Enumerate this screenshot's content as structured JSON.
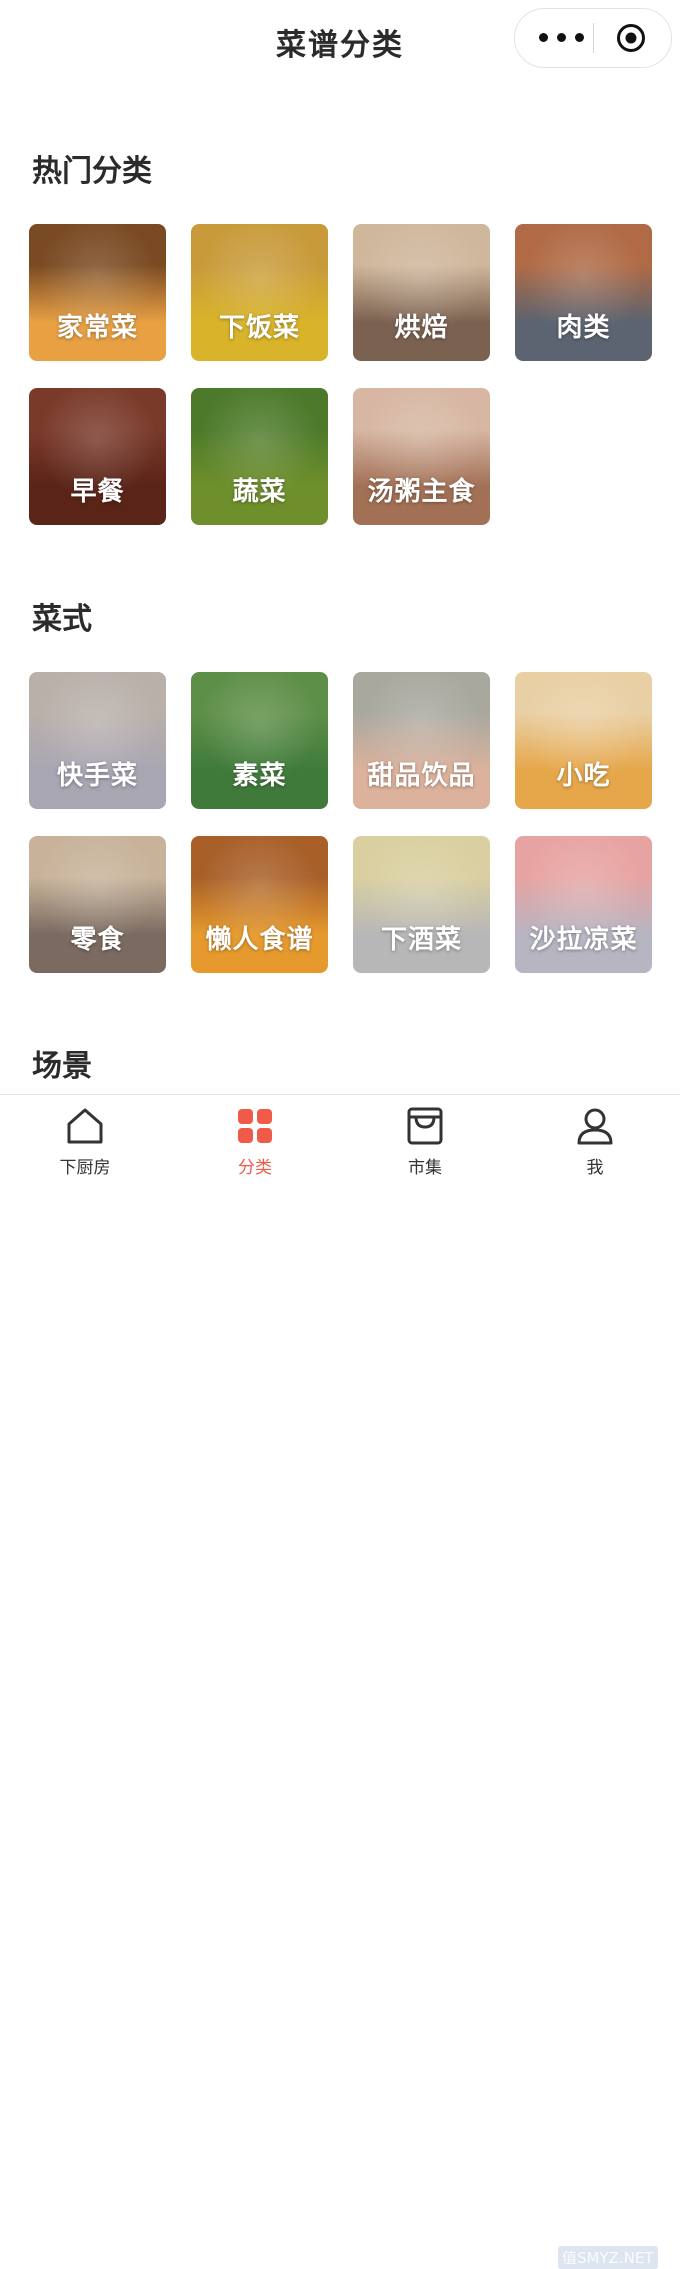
{
  "nav": {
    "title": "菜谱分类"
  },
  "sections": [
    {
      "title": "热门分类",
      "items": [
        {
          "label": "家常菜",
          "icon": "braised-pork-photo",
          "color": "#e8a043",
          "top": "#7a4a22"
        },
        {
          "label": "下饭菜",
          "icon": "rice-bowl-photo",
          "color": "#d9b42a",
          "top": "#c89a3a"
        },
        {
          "label": "烘焙",
          "icon": "bundt-cake-photo",
          "color": "#7b6150",
          "top": "#cfb79b"
        },
        {
          "label": "肉类",
          "icon": "pork-belly-photo",
          "color": "#5b6470",
          "top": "#b06a45"
        },
        {
          "label": "早餐",
          "icon": "breakfast-bread-photo",
          "color": "#5a2418",
          "top": "#7a3a2a"
        },
        {
          "label": "蔬菜",
          "icon": "salad-greens-photo",
          "color": "#6f8f2c",
          "top": "#4c7a2a"
        },
        {
          "label": "汤粥主食",
          "icon": "noodle-bowl-photo",
          "color": "#a27055",
          "top": "#d7b7a3"
        }
      ]
    },
    {
      "title": "菜式",
      "items": [
        {
          "label": "快手菜",
          "icon": "quick-dish-photo",
          "color": "#a8a6b3",
          "top": "#b9b0aa"
        },
        {
          "label": "素菜",
          "icon": "fig-salad-photo",
          "color": "#3f7a3a",
          "top": "#5e8f48"
        },
        {
          "label": "甜品饮品",
          "icon": "peach-drink-photo",
          "color": "#dcb29c",
          "top": "#a9a89f"
        },
        {
          "label": "小吃",
          "icon": "snack-pastry-photo",
          "color": "#e6a74a",
          "top": "#e9cfa4"
        },
        {
          "label": "零食",
          "icon": "popcorn-photo",
          "color": "#7a6a60",
          "top": "#c8b39a"
        },
        {
          "label": "懒人食谱",
          "icon": "lazy-noodles-photo",
          "color": "#e69a2e",
          "top": "#a85f28"
        },
        {
          "label": "下酒菜",
          "icon": "chicken-feet-photo",
          "color": "#b7b7b7",
          "top": "#d9cfa0"
        },
        {
          "label": "沙拉凉菜",
          "icon": "cold-salad-photo",
          "color": "#b7b5c2",
          "top": "#e7a3a1"
        }
      ]
    },
    {
      "title": "场景",
      "items": []
    }
  ],
  "tabs": [
    {
      "label": "下厨房",
      "icon": "house-icon",
      "active": false
    },
    {
      "label": "分类",
      "icon": "grid-icon",
      "active": true
    },
    {
      "label": "市集",
      "icon": "shop-icon",
      "active": false
    },
    {
      "label": "我",
      "icon": "person-icon",
      "active": false
    }
  ],
  "watermark": "值SMYZ.NET",
  "colors": {
    "accent": "#f05a48",
    "text": "#333333"
  }
}
